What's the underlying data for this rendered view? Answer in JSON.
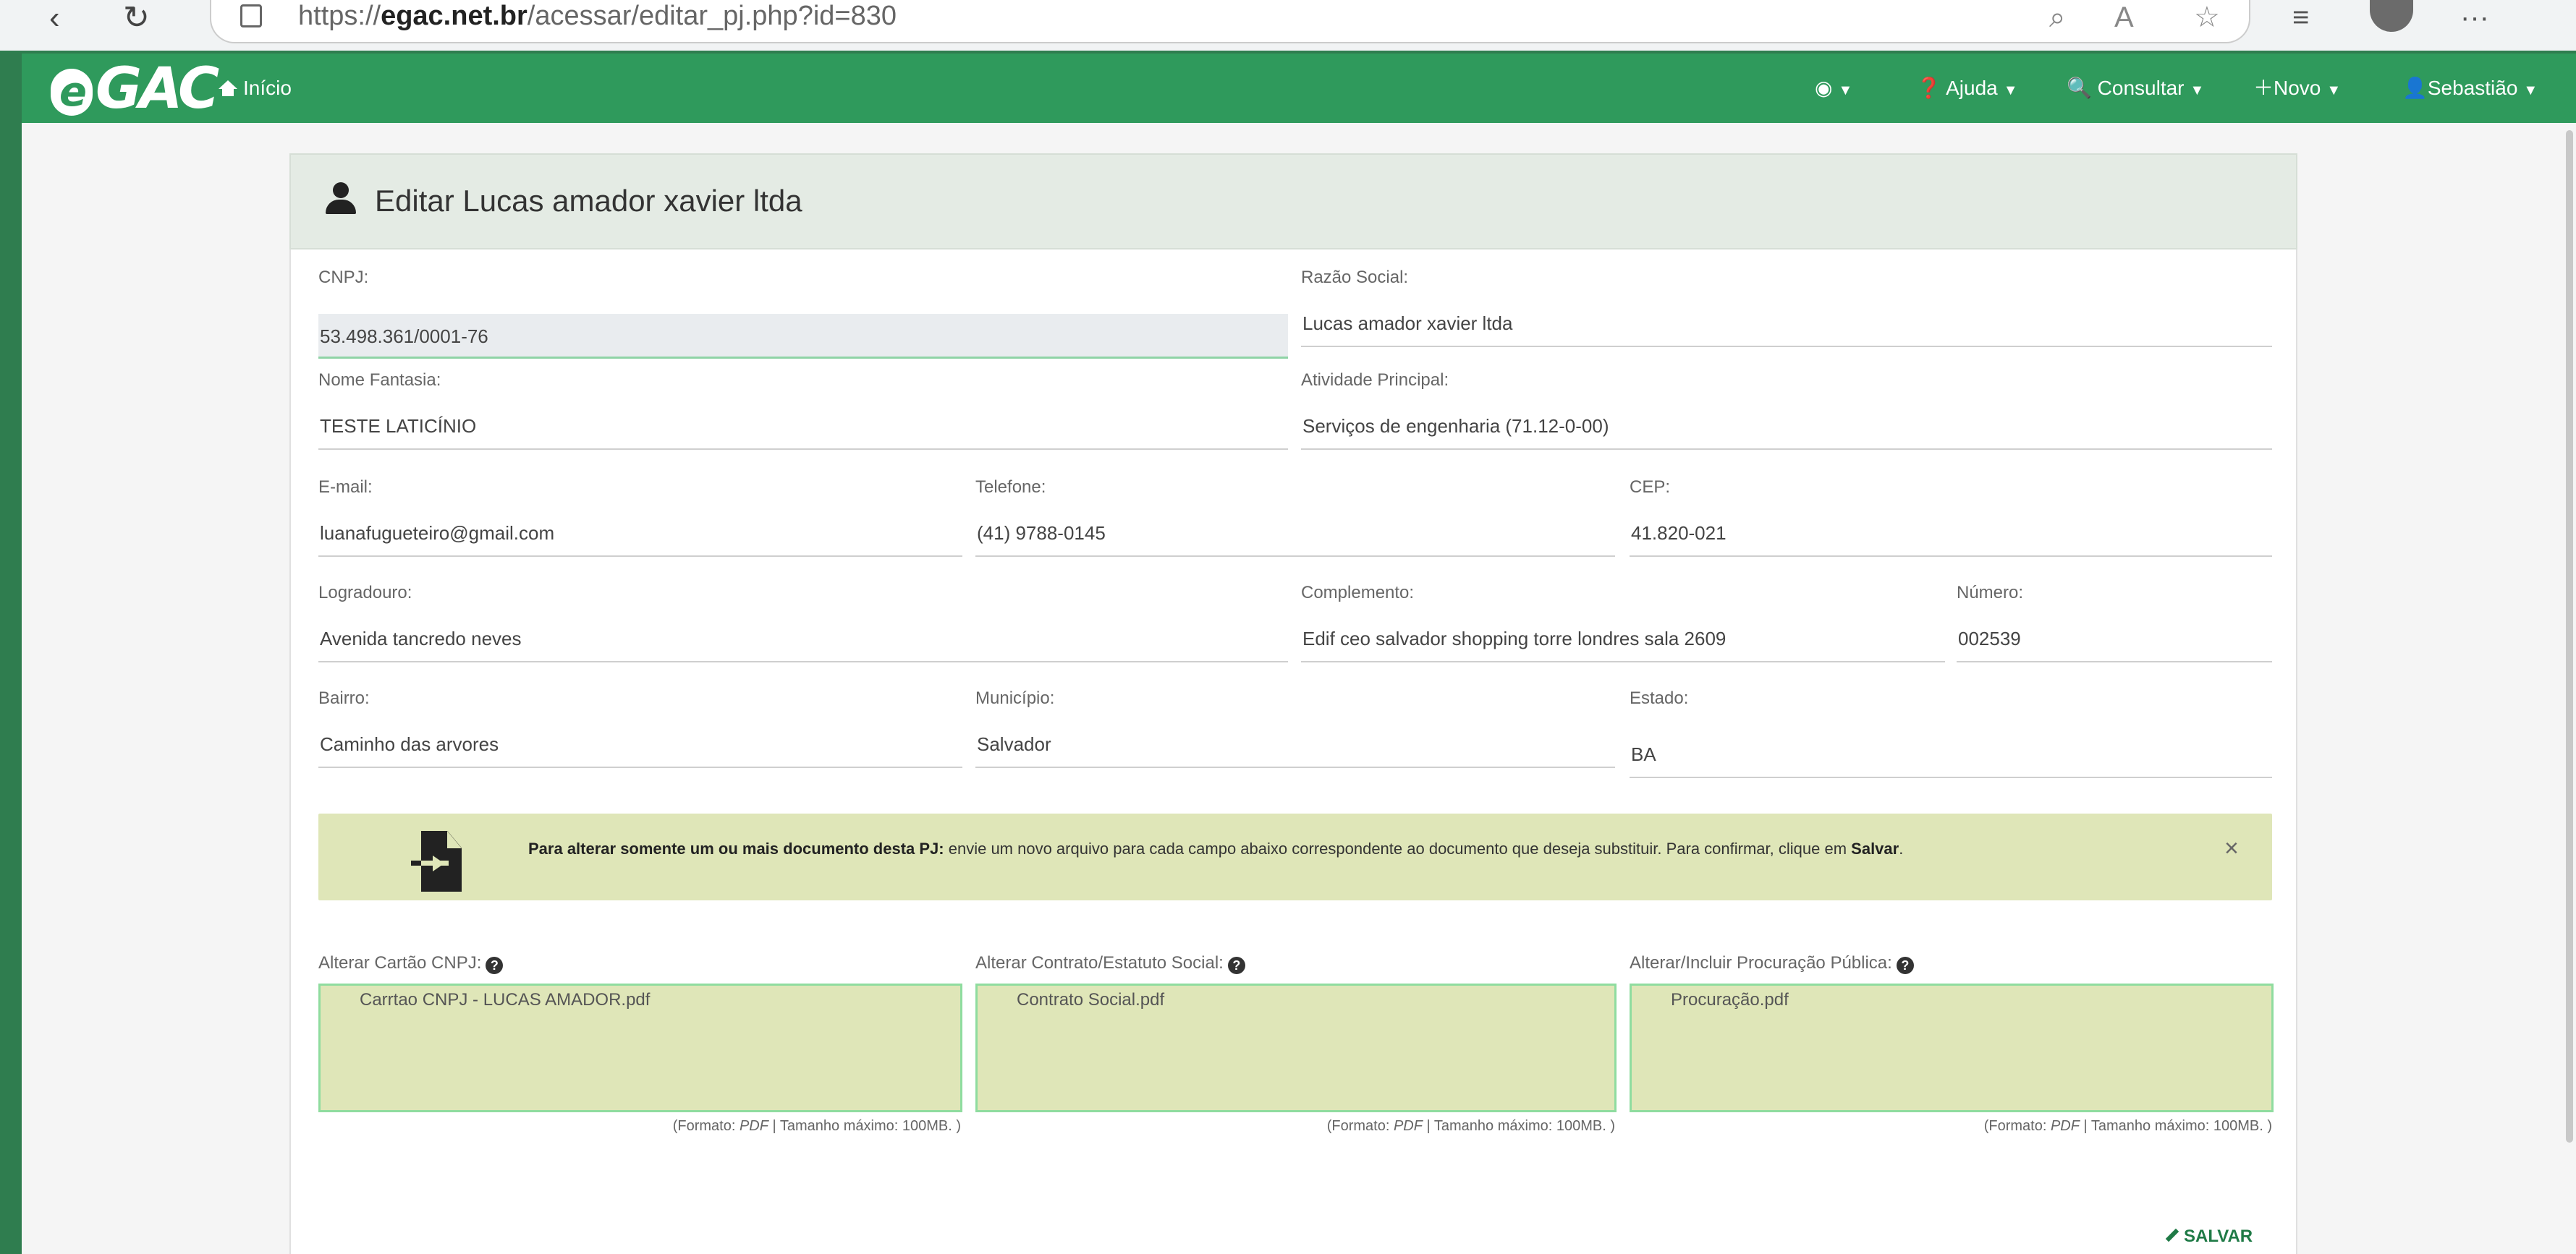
{
  "browser": {
    "url_prefix": "https://",
    "url_domain": "egac.net.br",
    "url_path": "/acessar/editar_pj.php?id=830",
    "menu_dots": "···"
  },
  "navbar": {
    "home": "Início",
    "help": "Ajuda",
    "consult": "Consultar",
    "new": "Novo",
    "user": "Sebastião"
  },
  "panel": {
    "title": "Editar Lucas amador xavier ltda"
  },
  "form": {
    "cnpj_label": "CNPJ:",
    "cnpj_value": "53.498.361/0001-76",
    "razao_label": "Razão Social:",
    "razao_value": "Lucas amador xavier ltda",
    "fantasia_label": "Nome Fantasia:",
    "fantasia_value": "TESTE LATICÍNIO",
    "atividade_label": "Atividade Principal:",
    "atividade_value": "Serviços de engenharia (71.12-0-00)",
    "email_label": "E-mail:",
    "email_value": "luanafugueteiro@gmail.com",
    "telefone_label": "Telefone:",
    "telefone_value": "(41) 9788-0145",
    "cep_label": "CEP:",
    "cep_value": "41.820-021",
    "logradouro_label": "Logradouro:",
    "logradouro_value": "Avenida tancredo neves",
    "complemento_label": "Complemento:",
    "complemento_value": "Edif ceo salvador shopping torre londres sala 2609",
    "numero_label": "Número:",
    "numero_value": "002539",
    "bairro_label": "Bairro:",
    "bairro_value": "Caminho das arvores",
    "municipio_label": "Município:",
    "municipio_value": "Salvador",
    "estado_label": "Estado:",
    "estado_value": "BA"
  },
  "alert": {
    "bold_text": "Para alterar somente um ou mais documento desta PJ:",
    "text": " envie um novo arquivo para cada campo abaixo correspondente ao documento que deseja substituir. Para confirmar, clique em ",
    "save_word": "Salvar",
    "end": ".",
    "close": "×"
  },
  "uploads": {
    "cnpj_label": "Alterar Cartão CNPJ:",
    "cnpj_file": "Carrtao CNPJ - LUCAS AMADOR.pdf",
    "contrato_label": "Alterar Contrato/Estatuto Social:",
    "contrato_file": "Contrato Social.pdf",
    "procuracao_label": "Alterar/Incluir Procuração Pública:",
    "procuracao_file": "Procuração.pdf",
    "hint_prefix": "(Formato: ",
    "hint_format": "PDF",
    "hint_suffix": " | Tamanho máximo: 100MB. )"
  },
  "actions": {
    "save": "SALVAR"
  },
  "colors": {
    "brand_green": "#2f9a5c",
    "alert_bg": "#dfe6b8",
    "upload_border": "#8fdc9f"
  }
}
